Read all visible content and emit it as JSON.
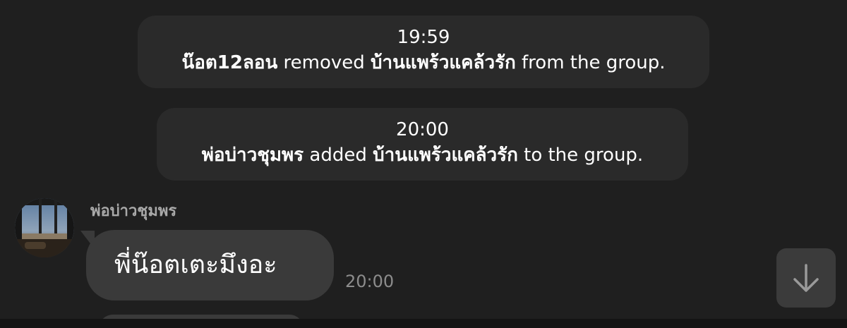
{
  "notices": [
    {
      "time": "19:59",
      "actor": "น๊อต12ลอน",
      "verb": " removed ",
      "target": "บ้านแพร้วแคล้วรัก",
      "suffix": " from the group."
    },
    {
      "time": "20:00",
      "actor": "พ่อบ่าวชุมพร",
      "verb": " added ",
      "target": "บ้านแพร้วแคล้วรัก",
      "suffix": " to the group."
    }
  ],
  "message": {
    "sender": "พ่อบ่าวชุมพร",
    "text": "พี่น๊อตเตะมึงอะ",
    "time": "20:00"
  },
  "icons": {
    "avatar": "avatar-photo",
    "scroll": "arrow-down-icon"
  },
  "colors": {
    "background": "#1f1f1f",
    "notice_bg": "#2a2a2a",
    "bubble_bg": "#3a3a3a",
    "sender_name": "#a9a9a9",
    "timestamp": "#8c8c8c"
  }
}
